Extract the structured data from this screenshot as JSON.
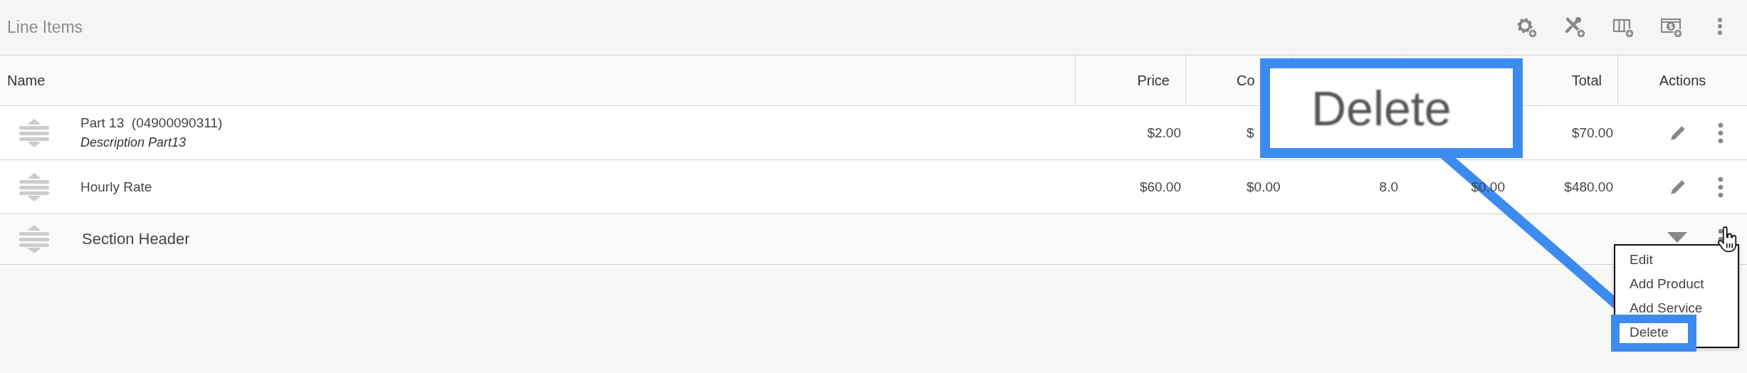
{
  "panel": {
    "title": "Line Items"
  },
  "table": {
    "columns": [
      {
        "label": "Name"
      },
      {
        "label": "Price"
      },
      {
        "label": "Co"
      },
      {},
      {},
      {
        "label": "Total"
      },
      {
        "label": "Actions"
      }
    ],
    "rows": [
      {
        "kind": "item",
        "name": "Part 13  (04900090311)",
        "description": "Description Part13",
        "cells": [
          "$2.00",
          "$",
          null,
          null,
          "$70.00"
        ]
      },
      {
        "kind": "item",
        "name": "Hourly Rate",
        "cells": [
          "$60.00",
          "$0.00",
          "8.0",
          "$0.00",
          "$480.00"
        ]
      },
      {
        "kind": "section",
        "name": "Section Header",
        "expanded": true
      }
    ]
  },
  "row_menu": {
    "items": [
      {
        "label": "Edit"
      },
      {
        "label": "Add Product"
      },
      {
        "label": "Add Service"
      },
      {
        "label": "Delete"
      }
    ]
  },
  "callout": {
    "text": "Delete"
  }
}
